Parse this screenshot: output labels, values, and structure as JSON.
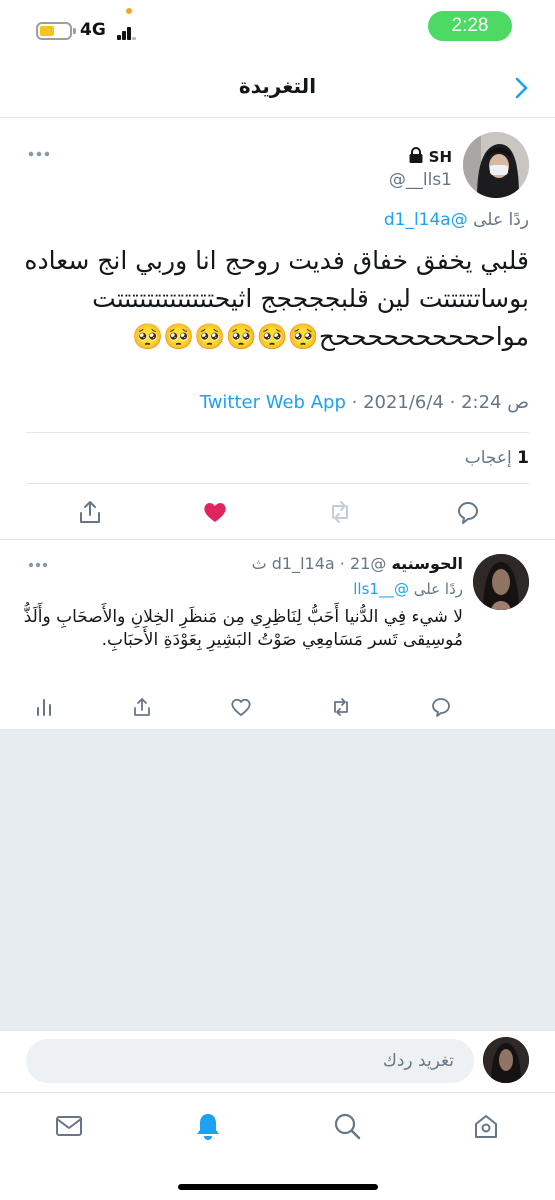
{
  "status_bar": {
    "network": "4G",
    "time": "2:28",
    "time_pill_color": "#4cd964",
    "battery_color": "#f5c518"
  },
  "header": {
    "title": "التغريدة",
    "back_icon": "chevron-right-icon"
  },
  "main_tweet": {
    "author_name": "SH",
    "author_handle": "@__lls1",
    "protected_icon": "lock-icon",
    "reply_prefix": "ردًا على",
    "reply_to": "@d1_l14a",
    "text": "قلبي يخفق خفاق فديت روحج انا وربي انج سعاده بوساتتتتتت لين قلبججججج اثيحتتتتتتتتتتتتتت مواححححححححححح🥺🥺🥺🥺🥺🥺",
    "source": "Twitter Web App",
    "time": "ص 2:24",
    "date": "2021/6/4",
    "likes_count": "1",
    "likes_label": "إعجاب",
    "liked": true,
    "like_color": "#e0245e",
    "accent_color": "#1da1f2"
  },
  "reply_tweet": {
    "author_name": "الحوسنيه",
    "author_handle": "@d1_l14a",
    "age": "21 ث",
    "reply_prefix": "ردًا على",
    "reply_to": "@__lls1",
    "text": "لا شيء فِي الدُّنيا أَحَبُّ لِنَاظِرِي مِن مَنظَرِ الخِلانِ والأَصحَابِ وأَلَذُّ مُوسِيقى تَسر مَسَامِعِي صَوْتُ البَشِيرِ بِعَوْدَةِ الأَحبَابِ."
  },
  "compose": {
    "placeholder": "تغريد ردك"
  },
  "tabbar": {
    "items": [
      "home-icon",
      "search-icon",
      "notifications-icon",
      "messages-icon"
    ],
    "active": "notifications-icon"
  }
}
